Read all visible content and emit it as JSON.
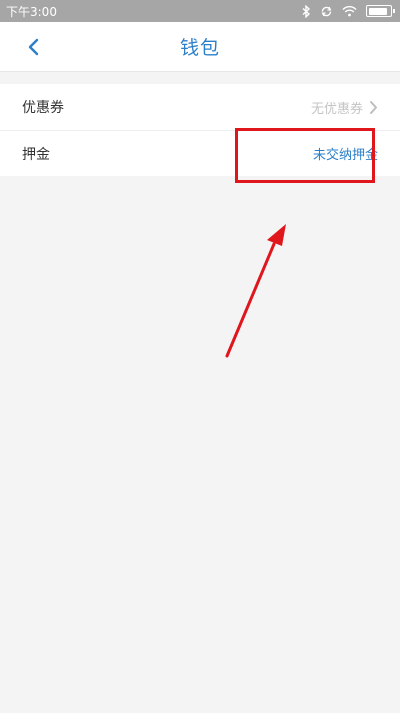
{
  "status_bar": {
    "time": "下午3:00",
    "icons": [
      "bluetooth-icon",
      "rotate-icon",
      "wifi-icon",
      "battery-icon"
    ],
    "battery_level": 0.9
  },
  "nav": {
    "title": "钱包",
    "back_icon": "chevron-left-icon"
  },
  "rows": [
    {
      "label": "优惠券",
      "value": "无优惠券",
      "has_chevron": true
    },
    {
      "label": "押金",
      "value": "未交纳押金",
      "has_chevron": false
    }
  ],
  "colors": {
    "accent": "#2b7fc8",
    "annotation": "#e0161d",
    "status_bar": "#a6a6a6",
    "background": "#f4f4f4"
  }
}
